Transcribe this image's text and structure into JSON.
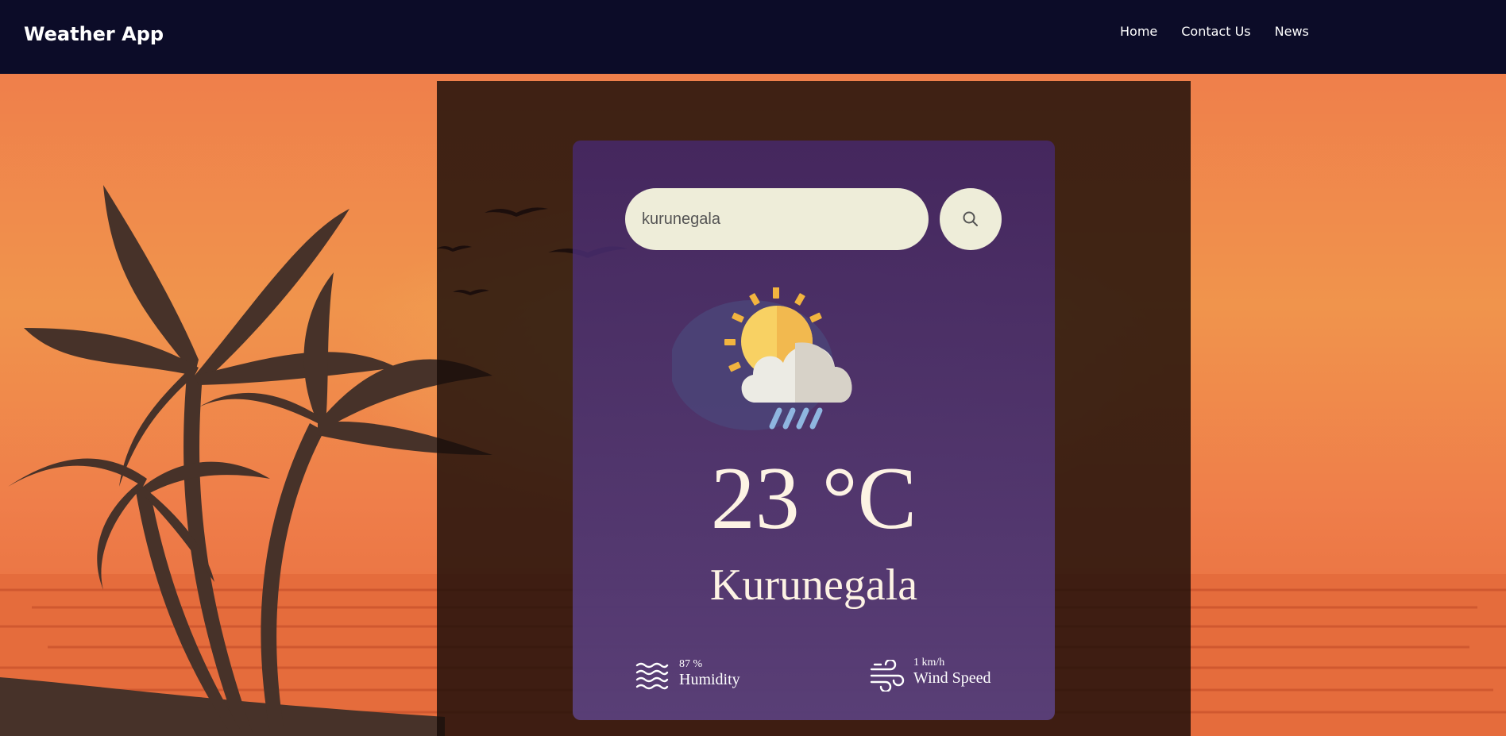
{
  "navbar": {
    "brand": "Weather App",
    "links": [
      {
        "label": "Home"
      },
      {
        "label": "Contact Us"
      },
      {
        "label": "News"
      }
    ]
  },
  "search": {
    "value": "kurunegala",
    "placeholder": ""
  },
  "weather": {
    "icon": "partly-cloudy-rain-icon",
    "temperature": "23 °C",
    "city": "Kurunegala",
    "humidity": {
      "value": "87 %",
      "label": "Humidity",
      "icon": "waves-icon"
    },
    "wind": {
      "value": "1 km/h",
      "label": "Wind Speed",
      "icon": "wind-icon"
    }
  },
  "colors": {
    "navbar": "#0c0c28",
    "sky": "#ef7e4a",
    "card_top": "#46286e",
    "card_bottom": "#5f468c",
    "input_bg": "#eeedd9",
    "text": "#fdf3e4"
  }
}
